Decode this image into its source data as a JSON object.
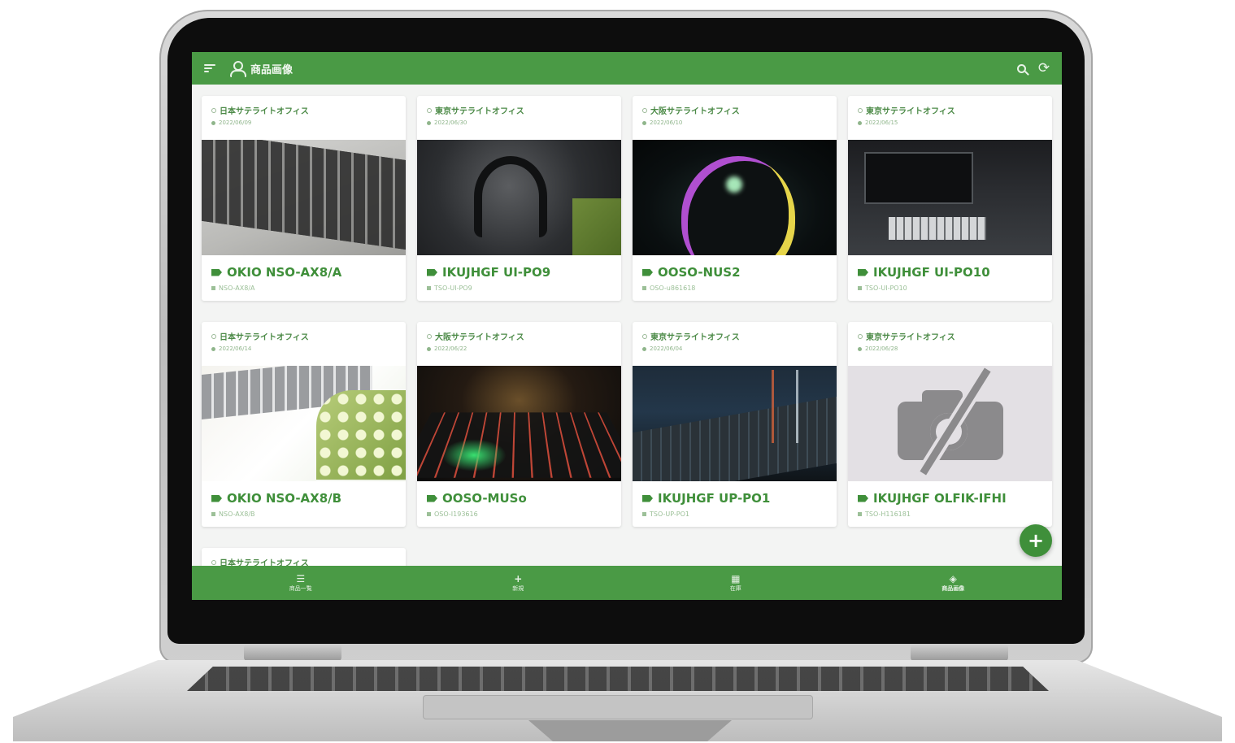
{
  "header": {
    "title": "商品画像",
    "menu_icon": "menu-icon",
    "search_icon": "search-icon",
    "refresh_icon": "refresh-icon"
  },
  "cards": [
    {
      "office": "日本サテライトオフィス",
      "date": "2022/06/09",
      "name": "OKIO NSO-AX8/A",
      "code": "NSO-AX8/A",
      "image": "laptop-keyboard"
    },
    {
      "office": "東京サテライトオフィス",
      "date": "2022/06/30",
      "name": "IKUJHGF UI-PO9",
      "code": "TSO-UI-PO9",
      "image": "gaming-headset"
    },
    {
      "office": "大阪サテライトオフィス",
      "date": "2022/06/10",
      "name": "OOSO-NUS2",
      "code": "OSO-u861618",
      "image": "rgb-mouse"
    },
    {
      "office": "東京サテライトオフィス",
      "date": "2022/06/15",
      "name": "IKUJHGF UI-PO10",
      "code": "TSO-UI-PO10",
      "image": "desk-setup"
    },
    {
      "office": "日本サテライトオフィス",
      "date": "2022/06/14",
      "name": "OKIO NSO-AX8/B",
      "code": "NSO-AX8/B",
      "image": "keyboard-flowers"
    },
    {
      "office": "大阪サテライトオフィス",
      "date": "2022/06/22",
      "name": "OOSO-MUSo",
      "code": "OSO-I193616",
      "image": "rgb-keyboard"
    },
    {
      "office": "東京サテライトオフィス",
      "date": "2022/06/04",
      "name": "IKUJHGF UP-PO1",
      "code": "TSO-UP-PO1",
      "image": "studio-mixer"
    },
    {
      "office": "東京サテライトオフィス",
      "date": "2022/06/28",
      "name": "IKUJHGF OLFIK-IFHI",
      "code": "TSO-H116181",
      "image": "no-image"
    }
  ],
  "partial_card": {
    "office": "日本サテライトオフィス"
  },
  "fab": {
    "label": "+"
  },
  "bottom_nav": [
    {
      "glyph": "☰",
      "label": "商品一覧",
      "icon": "list-icon"
    },
    {
      "glyph": "+",
      "label": "新規",
      "icon": "add-icon"
    },
    {
      "glyph": "▦",
      "label": "在庫",
      "icon": "calendar-icon"
    },
    {
      "glyph": "◈",
      "label": "商品画像",
      "icon": "image-icon"
    }
  ],
  "colors": {
    "primary": "#4a9a45",
    "accent": "#3f8f3a",
    "background": "#f3f4f3"
  }
}
